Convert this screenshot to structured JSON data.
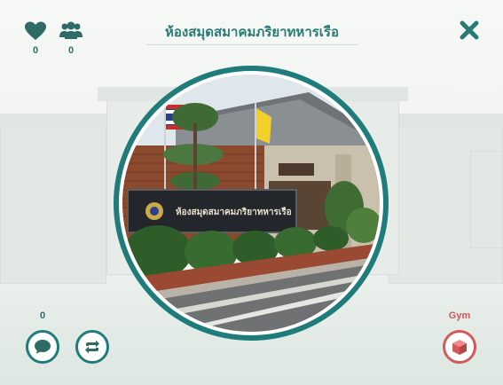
{
  "header": {
    "title": "ห้องสมุดสมาคมภริยาทหารเรือ",
    "likes_count": "0",
    "members_count": "0"
  },
  "icons": {
    "likes": "heart-icon",
    "members": "group-icon",
    "close": "close-icon",
    "comment": "chat-bubble-icon",
    "share": "repeat-icon",
    "gym": "cube-icon"
  },
  "photo": {
    "sign_text": "ห้องสมุดสมาคมภริยาทหารเรือ"
  },
  "footer": {
    "comment_count": "0",
    "gym_label": "Gym"
  },
  "colors": {
    "accent": "#1f7c7a",
    "gym": "#cf5656",
    "background": "#eef2ee"
  }
}
